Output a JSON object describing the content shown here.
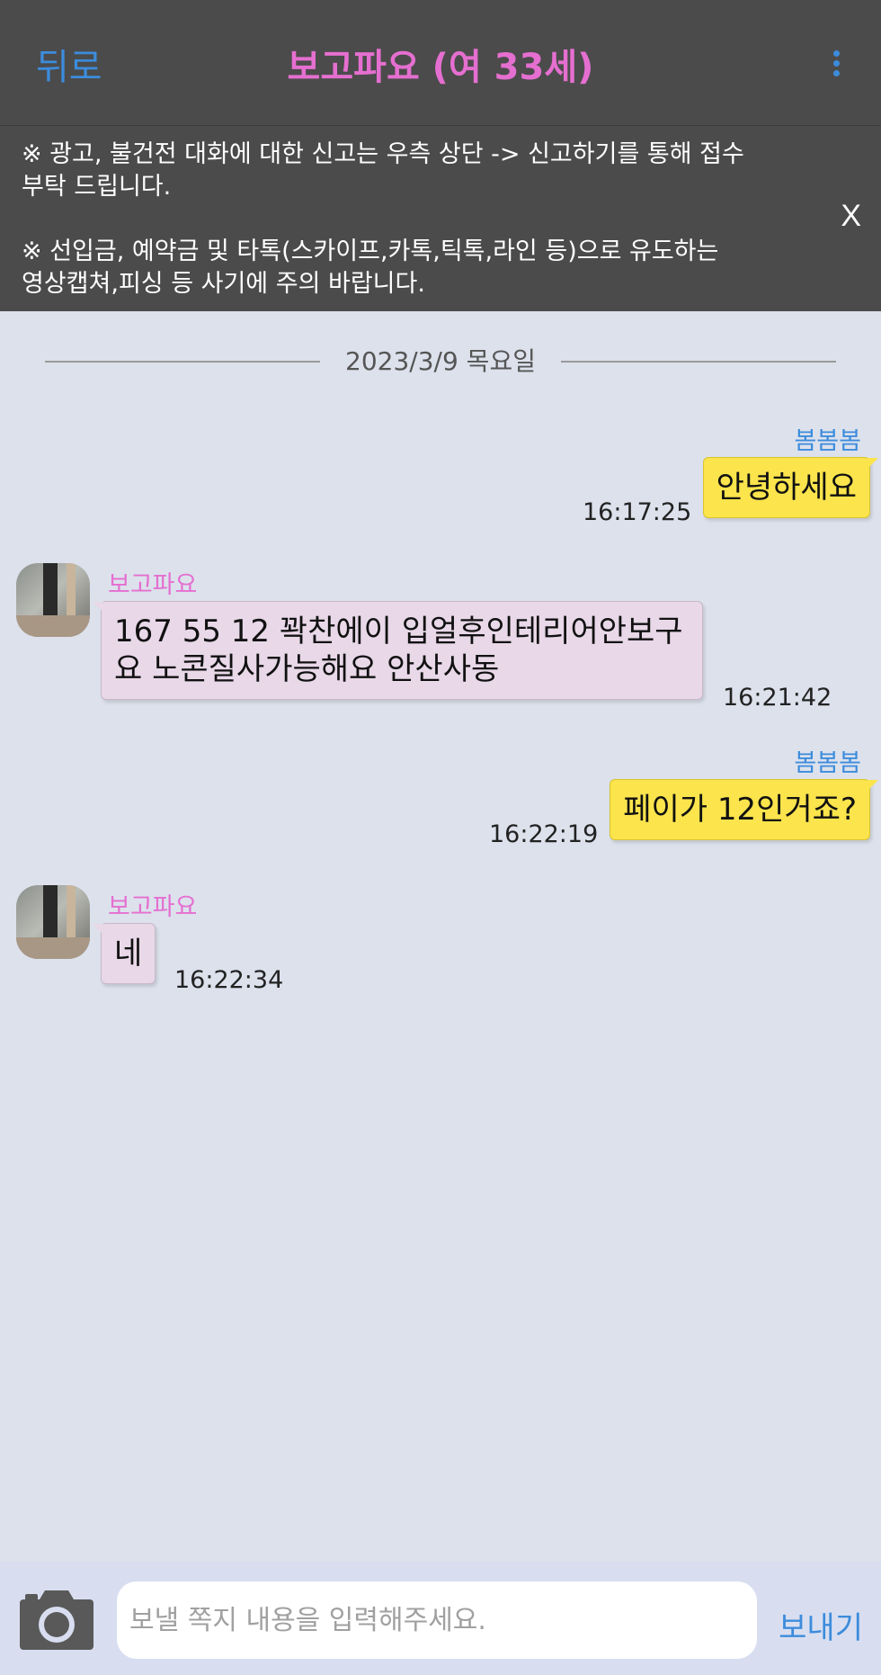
{
  "header": {
    "back_label": "뒤로",
    "title": "보고파요 (여 33세)",
    "menu_icon": "more-vertical-icon"
  },
  "notice": {
    "line1": "※ 광고, 불건전 대화에 대한 신고는 우측 상단 -> 신고하기를 통해 접수",
    "line2": "부탁 드립니다.",
    "line3": "※ 선입금, 예약금 및 타톡(스카이프,카톡,틱톡,라인 등)으로 유도하는",
    "line4": "영상캡쳐,피싱 등 사기에 주의 바랍니다.",
    "close_label": "X"
  },
  "date_separator": "2023/3/9 목요일",
  "messages": [
    {
      "from": "me",
      "sender": "봄봄봄",
      "text": "안녕하세요",
      "time": "16:17:25"
    },
    {
      "from": "them",
      "sender": "보고파요",
      "text_line1": "167 55 12 꽉찬에이 입얼후인테리어안보구",
      "text_line2": "요 노콘질사가능해요 안산사동",
      "time": "16:21:42"
    },
    {
      "from": "me",
      "sender": "봄봄봄",
      "text": "페이가 12인거죠?",
      "time": "16:22:19"
    },
    {
      "from": "them",
      "sender": "보고파요",
      "text": "네",
      "time": "16:22:34"
    }
  ],
  "composer": {
    "camera_icon": "camera-icon",
    "placeholder": "보낼 쪽지 내용을 입력해주세요.",
    "send_label": "보내기"
  },
  "colors": {
    "accent_blue": "#3c8cdc",
    "accent_pink": "#e56fd0",
    "my_bubble": "#fbe44c",
    "their_bubble": "#e8d8e8",
    "background": "#dce1ec",
    "header_bg": "#4b4b4b"
  }
}
